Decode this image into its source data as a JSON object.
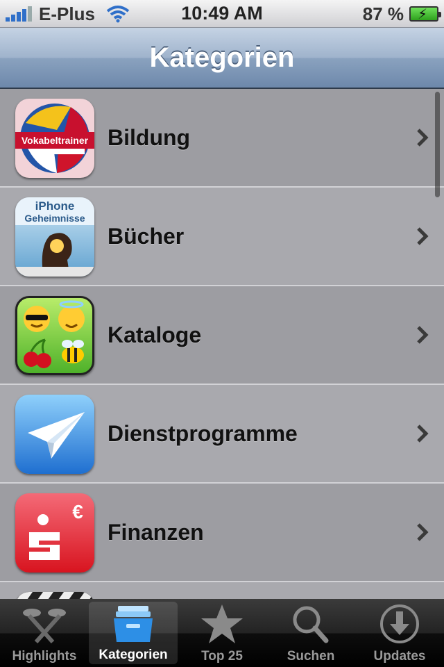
{
  "statusbar": {
    "carrier": "E-Plus",
    "time": "10:49 AM",
    "battery": "87 %"
  },
  "navbar": {
    "title": "Kategorien"
  },
  "categories": [
    {
      "label": "Bildung",
      "icon": "vokabeltrainer-app-icon",
      "icon_text": "Vokabeltrainer"
    },
    {
      "label": "Bücher",
      "icon": "iphone-geheimnisse-app-icon",
      "icon_text_1": "iPhone",
      "icon_text_2": "Geheimnisse"
    },
    {
      "label": "Kataloge",
      "icon": "emoji-app-icon"
    },
    {
      "label": "Dienstprogramme",
      "icon": "paper-plane-app-icon"
    },
    {
      "label": "Finanzen",
      "icon": "sparkasse-app-icon",
      "icon_text": "€"
    }
  ],
  "tabs": [
    {
      "label": "Highlights",
      "icon": "highlights-icon"
    },
    {
      "label": "Kategorien",
      "icon": "kategorien-icon",
      "active": true
    },
    {
      "label": "Top 25",
      "icon": "star-icon"
    },
    {
      "label": "Suchen",
      "icon": "search-icon"
    },
    {
      "label": "Updates",
      "icon": "download-icon"
    }
  ],
  "colors": {
    "tab_active": "#ffffff",
    "tab_inactive": "#9a9a9a",
    "nav_title": "#ffffff"
  }
}
